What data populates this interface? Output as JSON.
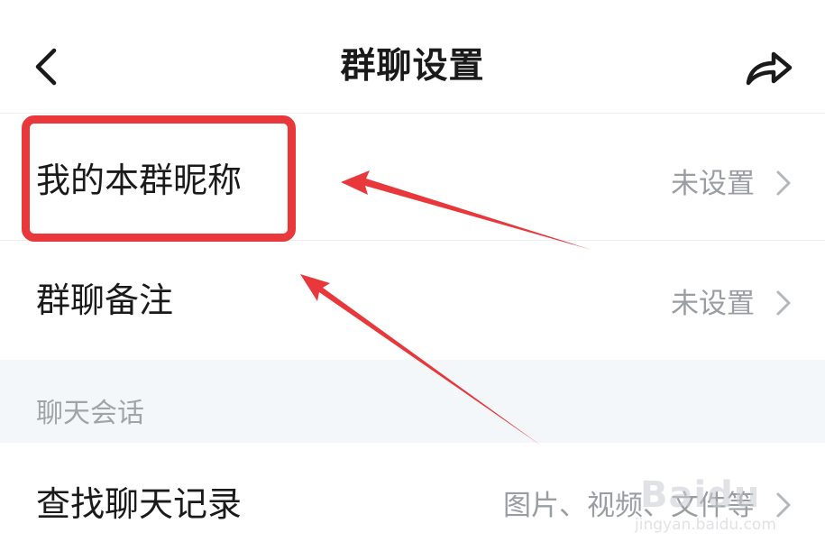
{
  "header": {
    "title": "群聊设置",
    "back_icon": "chevron-left-icon",
    "share_icon": "share-arrow-icon"
  },
  "rows": [
    {
      "label": "我的本群昵称",
      "value": "未设置"
    },
    {
      "label": "群聊备注",
      "value": "未设置"
    }
  ],
  "section": {
    "title": "聊天会话",
    "rows": [
      {
        "label": "查找聊天记录",
        "value": "图片、视频、文件等"
      }
    ]
  },
  "annotation": {
    "highlight_color": "#e8383b",
    "arrow_count": 2
  },
  "watermark": {
    "brand": "Baidu",
    "sub": "jingyan.baidu.com"
  },
  "colors": {
    "text_primary": "#1a1a1a",
    "text_secondary": "#9a9ea3",
    "section_bg": "#f3f7f9",
    "divider": "#eceff1"
  }
}
